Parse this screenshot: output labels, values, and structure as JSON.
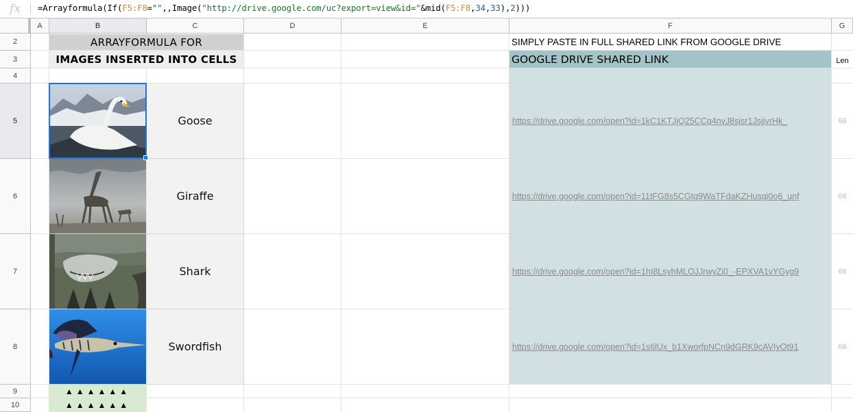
{
  "formula_bar": {
    "fx_label": "fx",
    "formula": [
      {
        "t": "=Arrayformula(If(",
        "k": "txt"
      },
      {
        "t": "F5:F8",
        "k": "rng"
      },
      {
        "t": "=",
        "k": "txt"
      },
      {
        "t": "\"\"",
        "k": "str"
      },
      {
        "t": ",,Image(",
        "k": "txt"
      },
      {
        "t": "\"http://drive.google.com/uc?export=view&id=\"",
        "k": "str"
      },
      {
        "t": "&mid(",
        "k": "txt"
      },
      {
        "t": "F5:F8",
        "k": "rng"
      },
      {
        "t": ",",
        "k": "txt"
      },
      {
        "t": "34",
        "k": "num"
      },
      {
        "t": ",",
        "k": "txt"
      },
      {
        "t": "33",
        "k": "num"
      },
      {
        "t": "),",
        "k": "txt"
      },
      {
        "t": "2",
        "k": "num"
      },
      {
        "t": ")))",
        "k": "txt"
      }
    ]
  },
  "columns": [
    "A",
    "B",
    "C",
    "D",
    "E",
    "F",
    "G"
  ],
  "rows": [
    "2",
    "3",
    "4",
    "5",
    "6",
    "7",
    "8",
    "9",
    "10"
  ],
  "title": {
    "line1": "ARRAYFORMULA FOR",
    "line2": "IMAGES INSERTED INTO CELLS"
  },
  "instructions": "SIMPLY PASTE IN FULL SHARED LINK FROM GOOGLE DRIVE",
  "link_header": "GOOGLE DRIVE SHARED LINK",
  "len_header": "Len",
  "animals": [
    {
      "image_icon": "goose-photo-icon",
      "name": "Goose",
      "link": "https://drive.google.com/open?id=1kC1KTJjQ25CCq4nvJ8sjsr1JsjjvrHk_",
      "len": "66"
    },
    {
      "image_icon": "giraffe-photo-icon",
      "name": "Giraffe",
      "link": "https://drive.google.com/open?id=11tFG8s5CGtg9WaTFdaKZHusqi0o6_unf",
      "len": "66"
    },
    {
      "image_icon": "shark-photo-icon",
      "name": "Shark",
      "link": "https://drive.google.com/open?id=1hI8LsyhMLOJJrwyZi0_-EPXVA1vYGyg9",
      "len": "66"
    },
    {
      "image_icon": "swordfish-photo-icon",
      "name": "Swordfish",
      "link": "https://drive.google.com/open?id=1s6lUx_b1XworfpNCn9dGRK9cAVIyOt91",
      "len": "66"
    }
  ],
  "triangle_rows": [
    "▲▲▲▲▲▲",
    "▲▲▲▲▲▲"
  ],
  "colors": {
    "title_band": "#d0d0d0",
    "title_band2": "#eeeeee",
    "link_header_bg": "#a2c4c9",
    "link_area_bg": "#d0e0e3",
    "triangle_bg": "#d9ead3",
    "selection": "#1a73e8"
  },
  "selected_cell": "B5"
}
